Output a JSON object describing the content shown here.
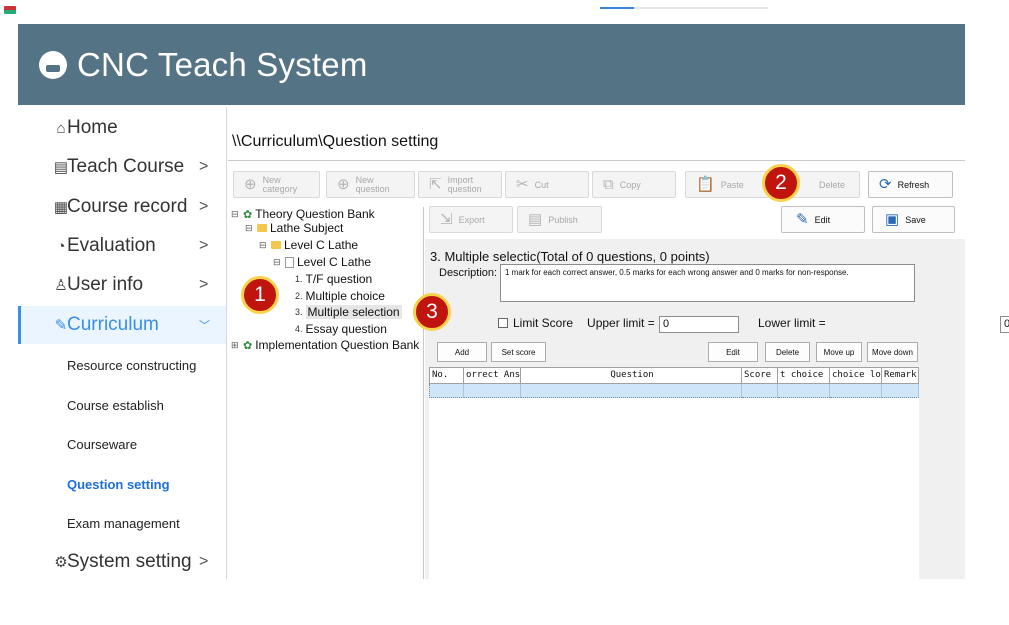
{
  "app": {
    "title": "CNC Teach System"
  },
  "sidebar": {
    "items": [
      {
        "label": "Home",
        "icon": "home-icon",
        "glyph": "⌂",
        "chevron": ""
      },
      {
        "label": "Teach Course",
        "icon": "book-icon",
        "glyph": "▤",
        "chevron": ">"
      },
      {
        "label": "Course record",
        "icon": "document-icon",
        "glyph": "▦",
        "chevron": ">"
      },
      {
        "label": "Evaluation",
        "icon": "pie-chart-icon",
        "glyph": "◔",
        "chevron": ">"
      },
      {
        "label": "User info",
        "icon": "user-icon",
        "glyph": "♙",
        "chevron": ">"
      },
      {
        "label": "Curriculum",
        "icon": "pencil-icon",
        "glyph": "✎",
        "chevron": "﹀"
      }
    ],
    "sub_items": [
      "Resource constructing",
      "Course establish",
      "Courseware",
      "Question setting",
      "Exam management"
    ],
    "system": {
      "label": "System setting",
      "icon": "gear-icon",
      "glyph": "⚙",
      "chevron": ">"
    }
  },
  "breadcrumb": "\\\\Curriculum\\Question setting",
  "toolbar": {
    "new_category": [
      "New",
      "category"
    ],
    "new_question": [
      "New",
      "question"
    ],
    "import_question": [
      "Import",
      "question"
    ],
    "cut": "Cut",
    "copy": "Copy",
    "paste": "Paste",
    "delete": "Delete",
    "refresh": "Refresh",
    "export": "Export",
    "publish": "Publish",
    "edit": "Edit",
    "save": "Save"
  },
  "tree": {
    "root1": "Theory Question Bank",
    "subject": "Lathe Subject",
    "level_folder": "Level C Lathe",
    "level_page": "Level C Lathe",
    "types": [
      {
        "index": "1.",
        "label": "T/F question"
      },
      {
        "index": "2.",
        "label": "Multiple choice"
      },
      {
        "index": "3.",
        "label": "Multiple selection"
      },
      {
        "index": "4.",
        "label": "Essay question"
      }
    ],
    "root2": "Implementation Question Bank"
  },
  "content": {
    "section_title": "3. Multiple selectic(Total of 0 questions, 0 points)",
    "description_label": "Description:",
    "description": "1 mark for each correct answer, 0.5 marks for each wrong answer and 0 marks for non-response.",
    "limit_score": "Limit Score",
    "upper_label": "Upper limit =",
    "upper_value": "0",
    "lower_label": "Lower limit =",
    "lower_value": "0"
  },
  "actions": {
    "add": "Add",
    "set_score": "Set score",
    "edit": "Edit",
    "delete": "Delete",
    "move_up": "Move up",
    "move_down": "Move down"
  },
  "grid": {
    "columns": [
      "No.",
      "orrect Ans",
      "Question",
      "Score",
      "t choice",
      "choice lo",
      "Remark"
    ]
  },
  "badges": [
    "1",
    "2",
    "3"
  ],
  "colors": {
    "header": "#547384",
    "accent": "#3a8ee6",
    "badge": "#c0140f",
    "badge_ring": "#f7d24a",
    "row_selected": "#cfe6f9"
  }
}
